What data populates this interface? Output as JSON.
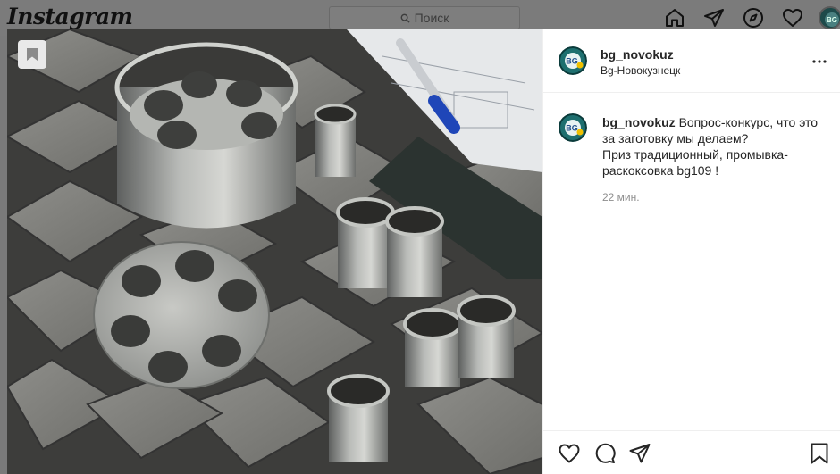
{
  "app": {
    "logo": "Instagram"
  },
  "search": {
    "placeholder": "Поиск"
  },
  "nav": {
    "icons": [
      "home-icon",
      "direct-icon",
      "explore-icon",
      "activity-heart-icon",
      "profile-avatar"
    ]
  },
  "post": {
    "username": "bg_novokuz",
    "location": "Bg-Новокузнецк",
    "caption_lines": [
      "Вопрос-конкурс, что это",
      "за заготовку мы делаем?",
      "Приз традиционный, промывка-",
      "раскоксовка bg109 !"
    ],
    "time": "22 мин.",
    "avatar_text": "BG"
  },
  "colors": {
    "text": "#262626",
    "muted": "#8e8e8e",
    "overlay": "#7b7b7b",
    "avatar": "#1e6f6f",
    "accent": "#f0c000"
  }
}
